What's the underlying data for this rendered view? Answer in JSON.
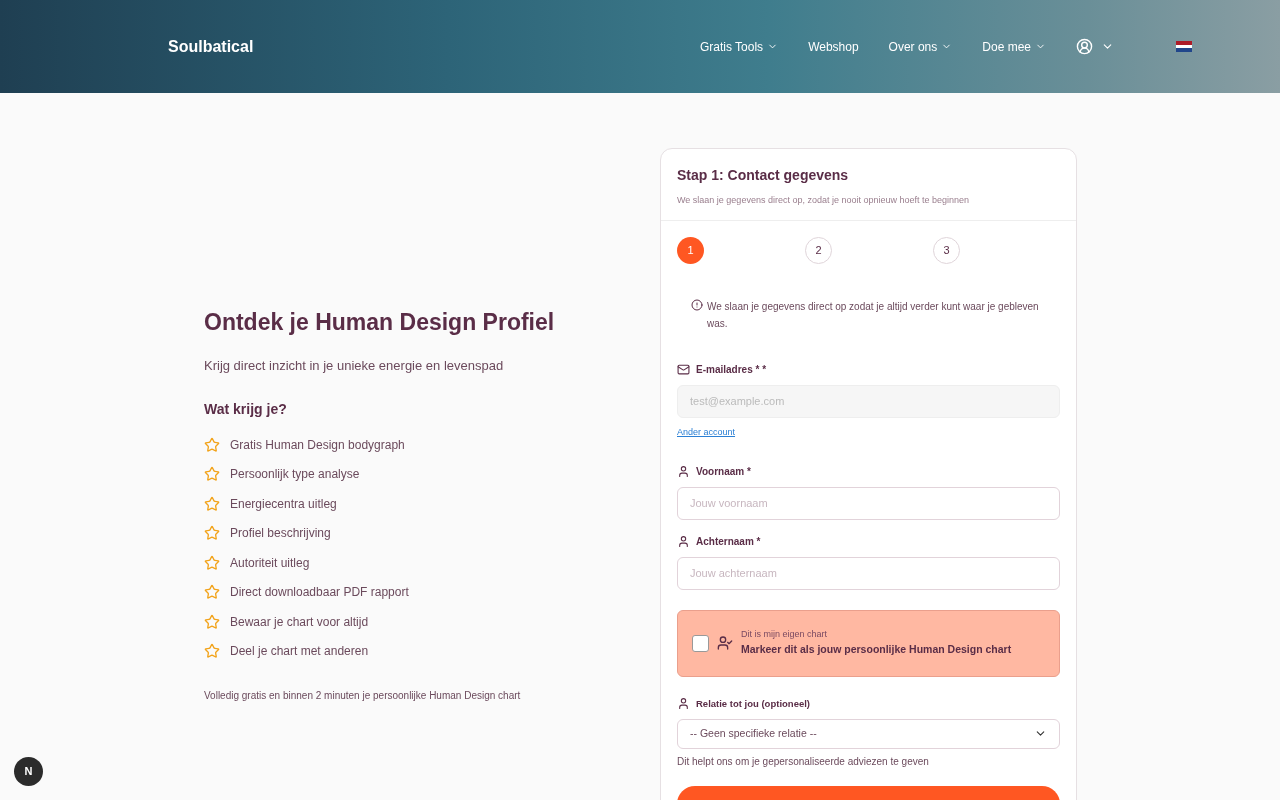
{
  "header": {
    "logo": "Soulbatical",
    "nav": [
      {
        "label": "Gratis Tools",
        "dropdown": true
      },
      {
        "label": "Webshop",
        "dropdown": false
      },
      {
        "label": "Over ons",
        "dropdown": true
      },
      {
        "label": "Doe mee",
        "dropdown": true
      }
    ]
  },
  "intro": {
    "title": "Ontdek je Human Design Profiel",
    "subtitle": "Krijg direct inzicht in je unieke energie en levenspad",
    "list_title": "Wat krijg je?",
    "benefits": [
      "Gratis Human Design bodygraph",
      "Persoonlijk type analyse",
      "Energiecentra uitleg",
      "Profiel beschrijving",
      "Autoriteit uitleg",
      "Direct downloadbaar PDF rapport",
      "Bewaar je chart voor altijd",
      "Deel je chart met anderen"
    ],
    "footnote": "Volledig gratis en binnen 2 minuten je persoonlijke Human Design chart"
  },
  "form": {
    "title": "Stap 1: Contact gegevens",
    "subtitle": "We slaan je gegevens direct op, zodat je nooit opnieuw hoeft te beginnen",
    "steps": [
      {
        "label": "1",
        "selected": true
      },
      {
        "label": "2",
        "selected": false
      },
      {
        "label": "3",
        "selected": false
      }
    ],
    "notice": "We slaan je gegevens direct op zodat je altijd verder kunt waar je gebleven was.",
    "email": {
      "label": "E-mailadres * *",
      "placeholder": "test@example.com",
      "disabled": true,
      "link": "Ander account"
    },
    "first_name": {
      "label": "Voornaam *",
      "placeholder": "Jouw voornaam"
    },
    "last_name": {
      "label": "Achternaam *",
      "placeholder": "Jouw achternaam"
    },
    "own_chart": {
      "checked": false,
      "caption": "Dit is mijn eigen chart",
      "label": "Markeer dit als jouw persoonlijke Human Design chart"
    },
    "relation": {
      "label": "Relatie tot jou (optioneel)",
      "value": "-- Geen specifieke relatie --",
      "help": "Dit helpt ons om je gepersonaliseerde adviezen te geven"
    }
  },
  "dev_badge": "N"
}
